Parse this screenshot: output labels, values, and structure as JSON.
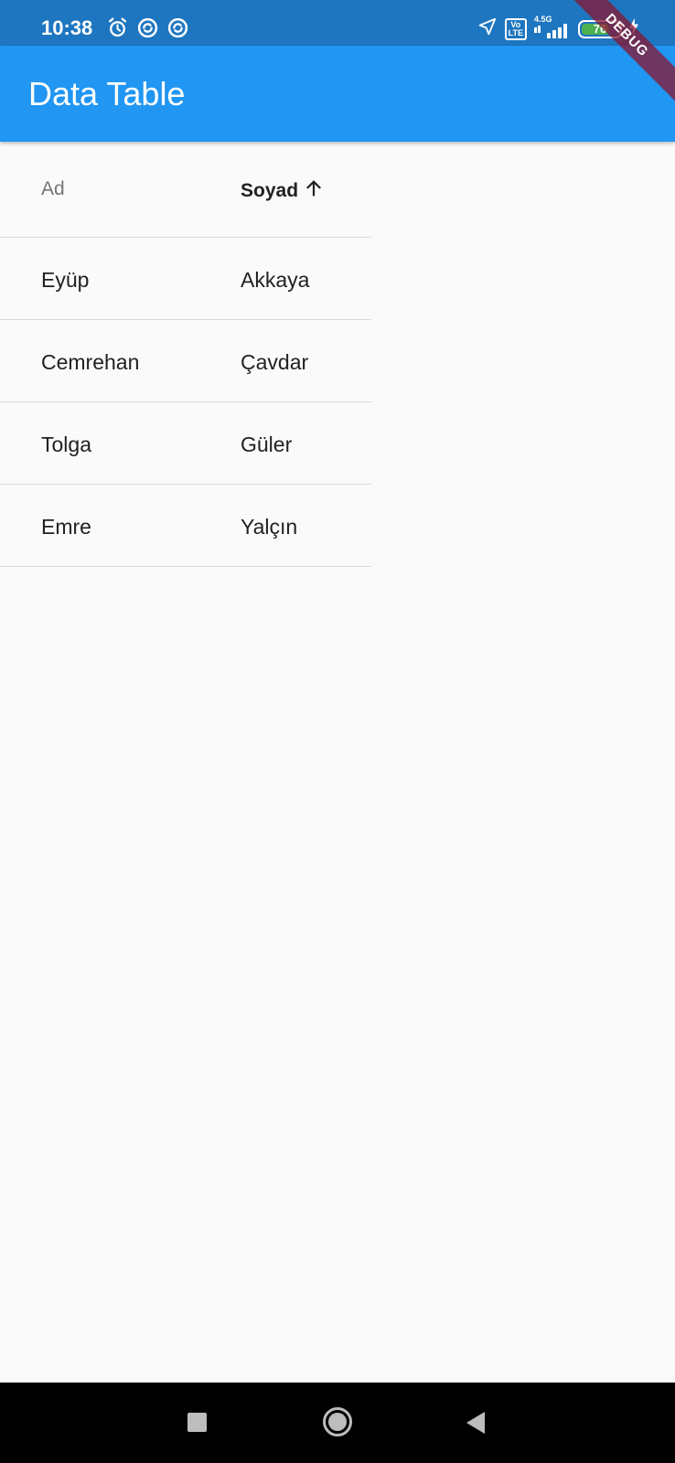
{
  "status_bar": {
    "time": "10:38",
    "network": "4.5G",
    "volte_top": "Vo",
    "volte_bottom": "LTE",
    "battery": "76",
    "battery_level": 0.76
  },
  "app_bar": {
    "title": "Data Table"
  },
  "debug_banner": "DEBUG",
  "table": {
    "columns": [
      {
        "label": "Ad"
      },
      {
        "label": "Soyad",
        "sorted": "ascending"
      }
    ],
    "rows": [
      {
        "ad": "Eyüp",
        "soyad": "Akkaya"
      },
      {
        "ad": "Cemrehan",
        "soyad": "Çavdar"
      },
      {
        "ad": "Tolga",
        "soyad": "Güler"
      },
      {
        "ad": "Emre",
        "soyad": "Yalçın"
      }
    ]
  },
  "colors": {
    "status_bar": "#1E76C0",
    "app_bar": "#2196F3",
    "background": "#FAFAFA",
    "divider": "#DADADA",
    "debug_ribbon": "#88162F"
  },
  "icons": {
    "status_left": [
      "alarm-icon",
      "sync-icon",
      "sync-icon"
    ],
    "status_right": [
      "location-arrow-icon",
      "volte-icon",
      "signal-icon",
      "battery-icon",
      "charging-icon"
    ],
    "sort": "arrow-up-icon",
    "nav": [
      "recents-square-icon",
      "home-circle-icon",
      "back-triangle-icon"
    ]
  }
}
